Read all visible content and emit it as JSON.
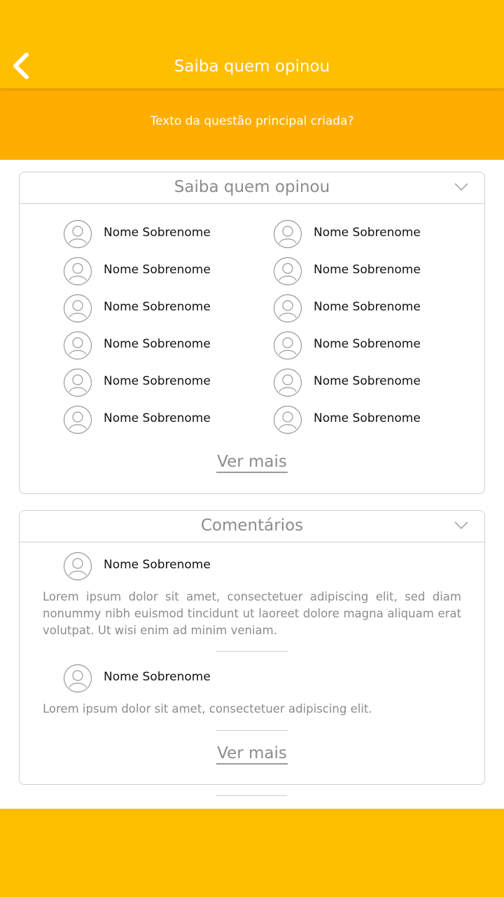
{
  "header": {
    "title": "Saiba quem opinou",
    "question": "Texto da questão principal criada?",
    "back_icon": "chevron-left-icon"
  },
  "colors": {
    "primary": "#FFBE00",
    "secondary": "#FFAE00",
    "muted_text": "#8c8c8c",
    "border": "#cfcfcf"
  },
  "voters": {
    "title": "Saiba quem opinou",
    "toggle_icon": "chevron-down-icon",
    "people": [
      "Nome Sobrenome",
      "Nome Sobrenome",
      "Nome Sobrenome",
      "Nome Sobrenome",
      "Nome Sobrenome",
      "Nome Sobrenome",
      "Nome Sobrenome",
      "Nome Sobrenome",
      "Nome Sobrenome",
      "Nome Sobrenome",
      "Nome Sobrenome",
      "Nome Sobrenome"
    ],
    "more_label": "Ver mais"
  },
  "comments": {
    "title": "Comentários",
    "toggle_icon": "chevron-down-icon",
    "items": [
      {
        "name": "Nome Sobrenome",
        "text": "Lorem ipsum dolor sit amet, consectetuer adipiscing elit, sed diam nonummy nibh euismod tincidunt ut laoreet dolore magna aliquam erat volutpat. Ut wisi enim ad minim veniam."
      },
      {
        "name": "Nome Sobrenome",
        "text": "Lorem ipsum dolor sit amet, consectetuer adipiscing elit."
      }
    ],
    "more_label": "Ver mais"
  }
}
